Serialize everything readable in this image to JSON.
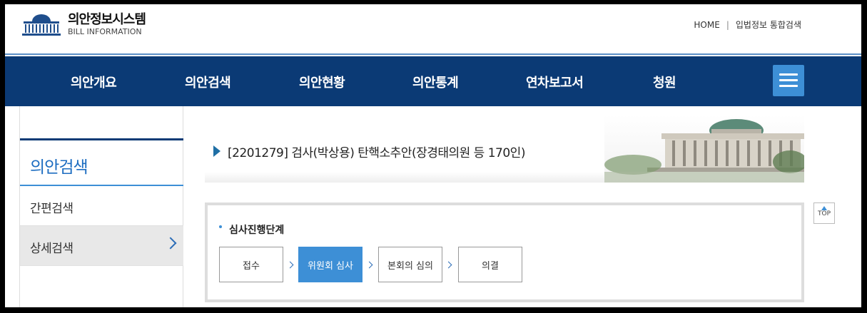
{
  "header": {
    "logo_title": "의안정보시스템",
    "logo_subtitle": "BILL INFORMATION",
    "util_links": [
      "HOME",
      "입법정보 통합검색"
    ],
    "separator": "|"
  },
  "gnb": {
    "items": [
      "의안개요",
      "의안검색",
      "의안현황",
      "의안통계",
      "연차보고서",
      "청원"
    ],
    "menu_icon": "hamburger-icon"
  },
  "sidebar": {
    "title": "의안검색",
    "items": [
      {
        "label": "간편검색",
        "active": false
      },
      {
        "label": "상세검색",
        "active": true
      }
    ]
  },
  "bill": {
    "title": "[2201279] 검사(박상용) 탄핵소추안(장경태의원 등 170인)"
  },
  "progress": {
    "title": "심사진행단계",
    "steps": [
      {
        "label": "접수",
        "active": false
      },
      {
        "label": "위원회 심사",
        "active": true
      },
      {
        "label": "본회의 심의",
        "active": false
      },
      {
        "label": "의결",
        "active": false
      }
    ]
  },
  "top_button": {
    "label": "TOP"
  },
  "colors": {
    "nav_bg": "#0b3a75",
    "accent": "#3d8fd6",
    "side_title": "#1d6dc1"
  }
}
